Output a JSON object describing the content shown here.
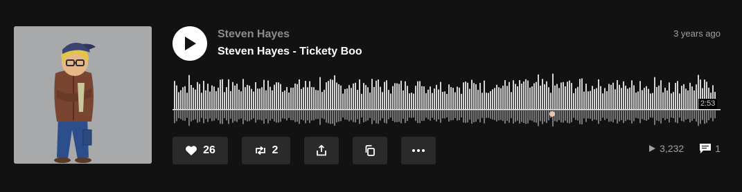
{
  "track": {
    "artist": "Steven Hayes",
    "title": "Steven Hayes - Tickety Boo",
    "posted": "3 years ago",
    "duration": "2:53"
  },
  "actions": {
    "likes": "26",
    "reposts": "2"
  },
  "stats": {
    "plays": "3,232",
    "comments": "1"
  },
  "colors": {
    "background": "#121212",
    "button_bg": "#2a2a2a",
    "waveform": "#d6d6d6",
    "artist": "#8c8c8c"
  }
}
